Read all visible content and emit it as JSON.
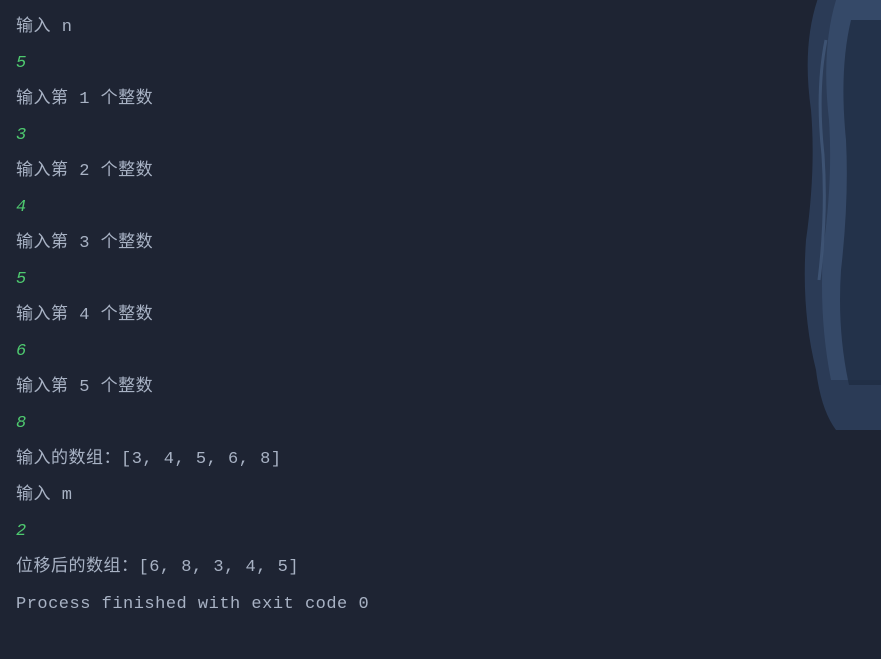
{
  "terminal": {
    "lines": [
      {
        "text": "输入 n",
        "type": "output"
      },
      {
        "text": "5",
        "type": "input"
      },
      {
        "text": "输入第 1 个整数",
        "type": "output"
      },
      {
        "text": "3",
        "type": "input"
      },
      {
        "text": "输入第 2 个整数",
        "type": "output"
      },
      {
        "text": "4",
        "type": "input"
      },
      {
        "text": "输入第 3 个整数",
        "type": "output"
      },
      {
        "text": "5",
        "type": "input"
      },
      {
        "text": "输入第 4 个整数",
        "type": "output"
      },
      {
        "text": "6",
        "type": "input"
      },
      {
        "text": "输入第 5 个整数",
        "type": "output"
      },
      {
        "text": "8",
        "type": "input"
      },
      {
        "text": "输入的数组：[3, 4, 5, 6, 8]",
        "type": "output"
      },
      {
        "text": "输入 m",
        "type": "output"
      },
      {
        "text": "2",
        "type": "input"
      },
      {
        "text": "位移后的数组：[6, 8, 3, 4, 5]",
        "type": "output"
      },
      {
        "text": "",
        "type": "output"
      },
      {
        "text": "Process finished with exit code 0",
        "type": "output"
      }
    ]
  }
}
